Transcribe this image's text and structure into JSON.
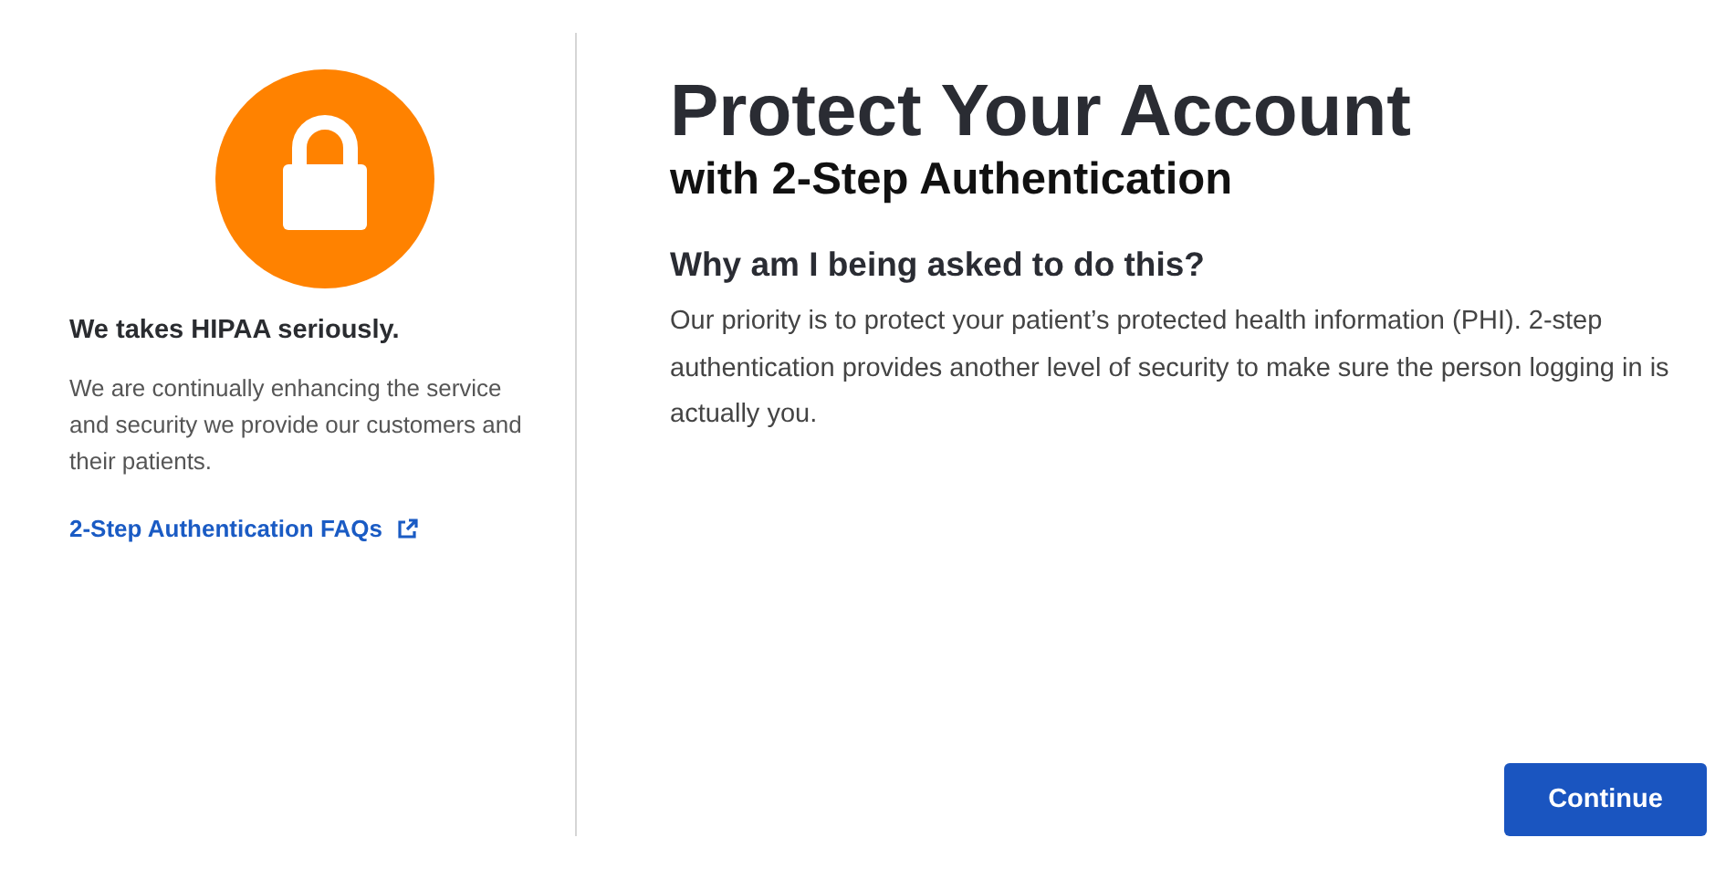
{
  "sidebar": {
    "heading": "We takes HIPAA seriously.",
    "text": "We are continually enhancing the service and security we provide our customers and their patients.",
    "link": "2-Step Authentication FAQs"
  },
  "main": {
    "title": "Protect Your Account",
    "subtitle": "with 2-Step Authentication",
    "question": "Why am I being asked to do this?",
    "text": "Our priority is to protect your patient’s protected health information (PHI). 2-step authentication provides another level of security to make sure the person logging in is actually you."
  },
  "buttons": [
    "Continue"
  ]
}
